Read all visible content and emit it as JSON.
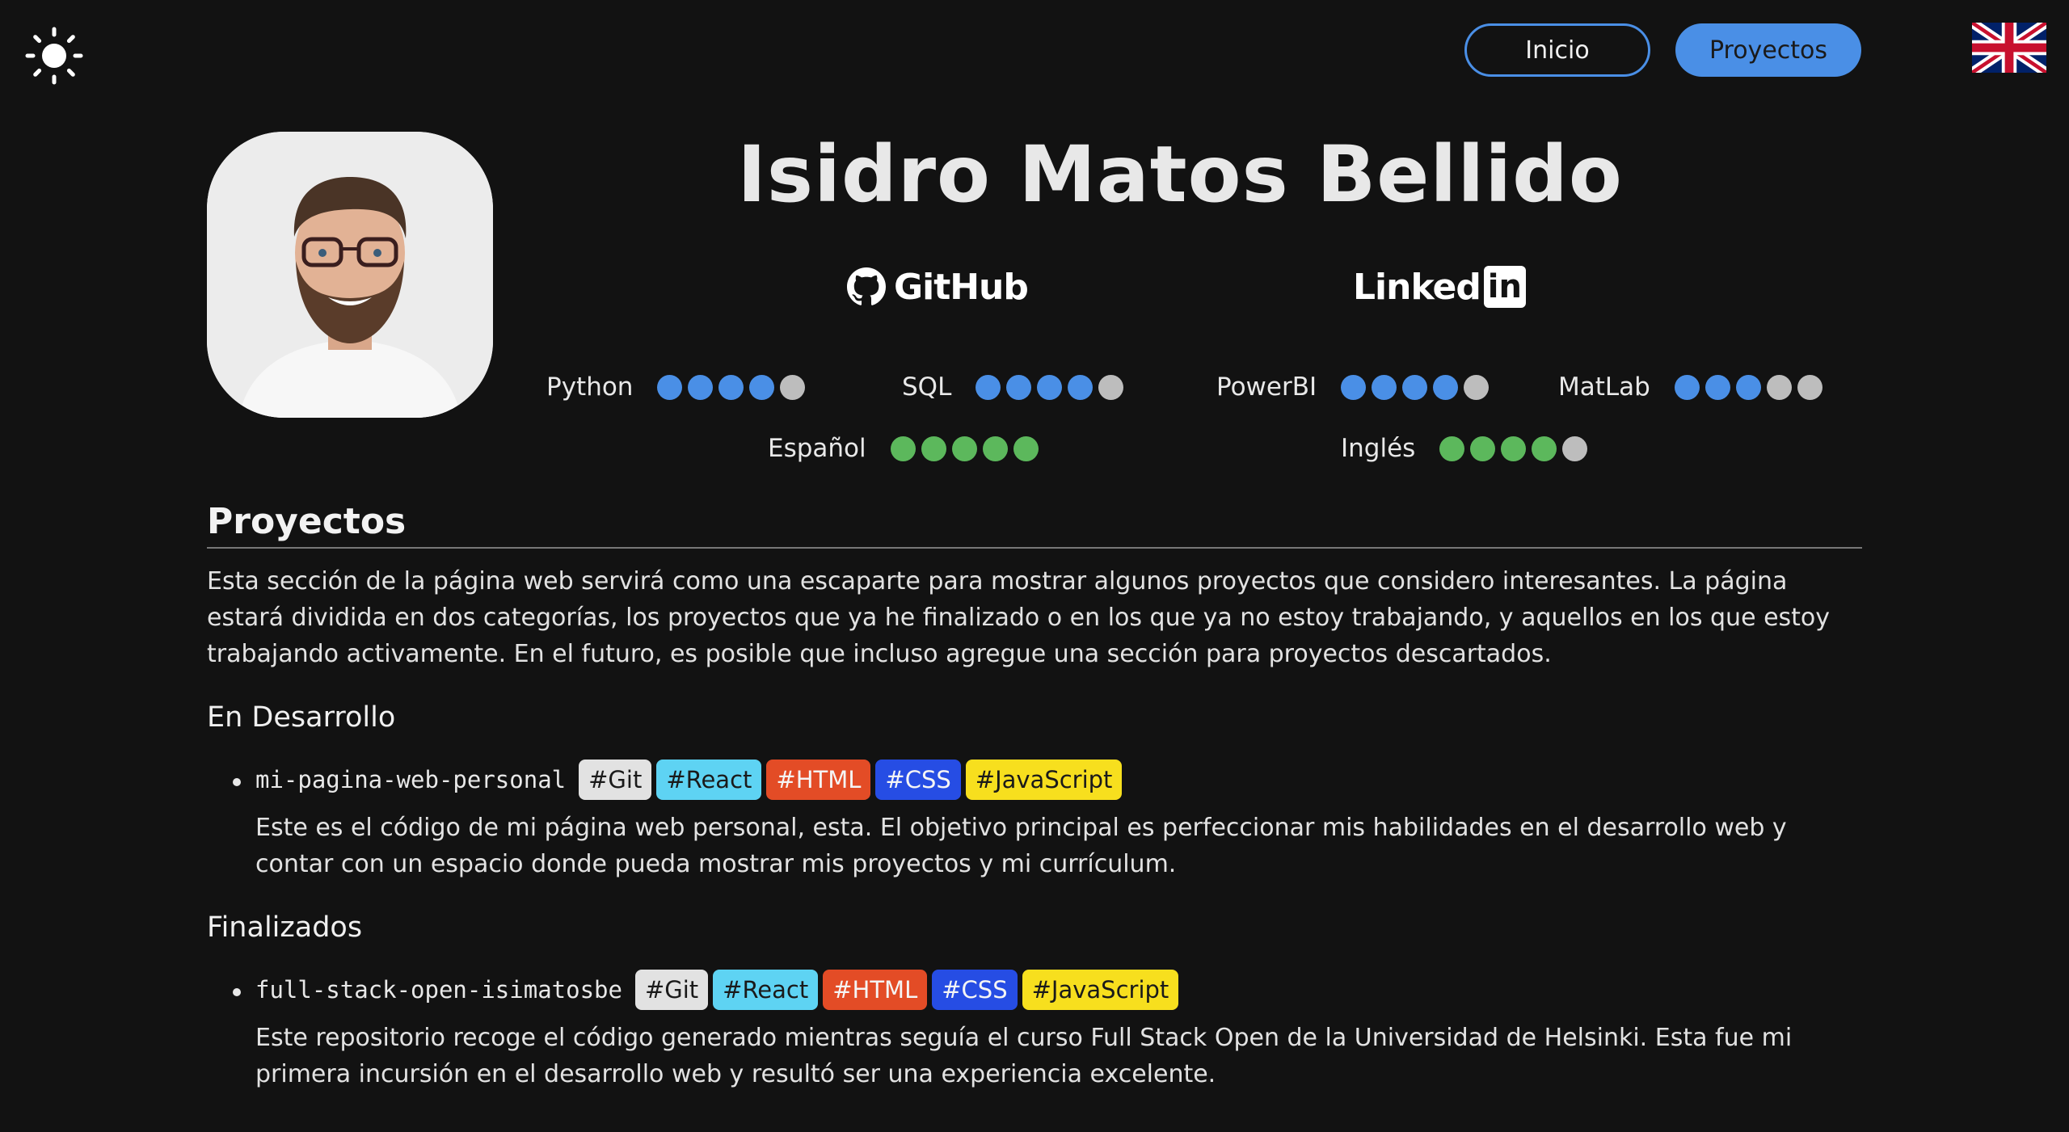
{
  "header": {
    "theme_icon": "sun-icon",
    "nav": [
      {
        "label": "Inicio"
      },
      {
        "label": "Proyectos"
      }
    ],
    "language_icon": "uk-flag-icon",
    "accent_color": "#4a8fe6"
  },
  "profile": {
    "name": "Isidro Matos Bellido",
    "github_label": "GitHub",
    "linkedin_label": "Linked",
    "linkedin_box": "in"
  },
  "skills": [
    {
      "label": "Python",
      "level": 4,
      "max": 5
    },
    {
      "label": "SQL",
      "level": 4,
      "max": 5
    },
    {
      "label": "PowerBI",
      "level": 4,
      "max": 5
    },
    {
      "label": "MatLab",
      "level": 3,
      "max": 5
    }
  ],
  "languages": [
    {
      "label": "Español",
      "level": 5,
      "max": 5
    },
    {
      "label": "Inglés",
      "level": 4,
      "max": 5
    }
  ],
  "projects_section": {
    "title": "Proyectos",
    "intro": "Esta sección de la página web servirá como una escaparte para mostrar algunos proyectos que considero interesantes. La página estará dividida en dos categorías, los proyectos que ya he finalizado o en los que ya no estoy trabajando, y aquellos en los que estoy trabajando activamente. En el futuro, es posible que incluso agregue una sección para proyectos descartados.",
    "in_progress": {
      "title": "En Desarrollo",
      "items": [
        {
          "name": "mi-pagina-web-personal",
          "tags": [
            "#Git",
            "#React",
            "#HTML",
            "#CSS",
            "#JavaScript"
          ],
          "description": "Este es el código de mi página web personal, esta. El objetivo principal es perfeccionar mis habilidades en el desarrollo web y contar con un espacio donde pueda mostrar mis proyectos y mi currículum."
        }
      ]
    },
    "finished": {
      "title": "Finalizados",
      "items": [
        {
          "name": "full-stack-open-isimatosbe",
          "tags": [
            "#Git",
            "#React",
            "#HTML",
            "#CSS",
            "#JavaScript"
          ],
          "description": "Este repositorio recoge el código generado mientras seguía el curso Full Stack Open de la Universidad de Helsinki. Esta fue mi primera incursión en el desarrollo web y resultó ser una experiencia excelente."
        }
      ]
    }
  },
  "tag_colors": {
    "#Git": "#e2e2e2",
    "#React": "#5ed3f3",
    "#HTML": "#e34c26",
    "#CSS": "#264de4",
    "#JavaScript": "#f7df1e"
  }
}
